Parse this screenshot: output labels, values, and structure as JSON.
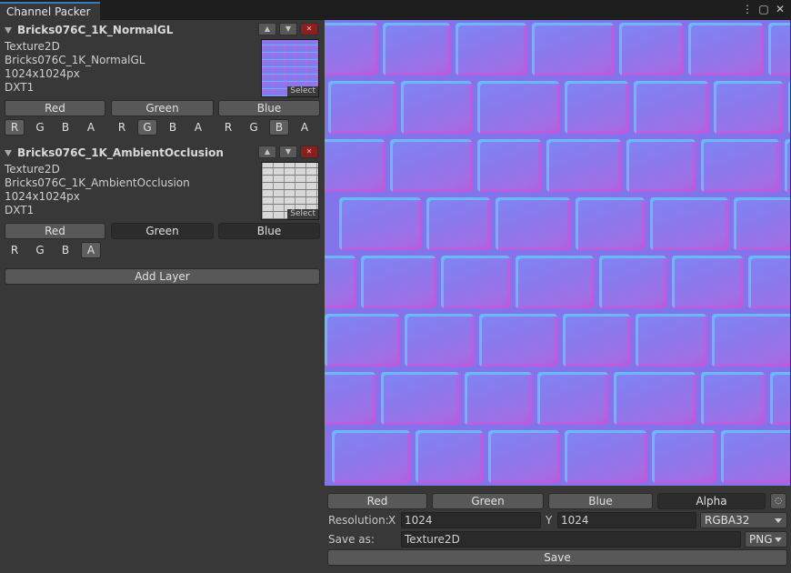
{
  "window": {
    "tab_title": "Channel Packer",
    "icons": [
      "more-vert-icon",
      "maximize-icon",
      "close-icon"
    ]
  },
  "layers": [
    {
      "name": "Bricks076C_1K_NormalGL",
      "type": "Texture2D",
      "asset": "Bricks076C_1K_NormalGL",
      "size": "1024x1024px",
      "format": "DXT1",
      "select_label": "Select",
      "outputs": [
        "Red",
        "Green",
        "Blue"
      ],
      "channels": [
        "R",
        "G",
        "B",
        "A"
      ],
      "selected_channels": [
        "R",
        "G",
        "B"
      ]
    },
    {
      "name": "Bricks076C_1K_AmbientOcclusion",
      "type": "Texture2D",
      "asset": "Bricks076C_1K_AmbientOcclusion",
      "size": "1024x1024px",
      "format": "DXT1",
      "select_label": "Select",
      "outputs": [
        "Red",
        "Green",
        "Blue"
      ],
      "channels": [
        "R",
        "G",
        "B",
        "A"
      ],
      "selected_channels": [
        "A"
      ]
    }
  ],
  "add_layer_label": "Add Layer",
  "preview_channels": [
    "Red",
    "Green",
    "Blue",
    "Alpha"
  ],
  "resolution": {
    "label": "Resolution:",
    "x_label": "X",
    "x_value": "1024",
    "y_label": "Y",
    "y_value": "1024",
    "format": "RGBA32"
  },
  "save": {
    "label": "Save as:",
    "name": "Texture2D",
    "format": "PNG",
    "button_label": "Save"
  }
}
